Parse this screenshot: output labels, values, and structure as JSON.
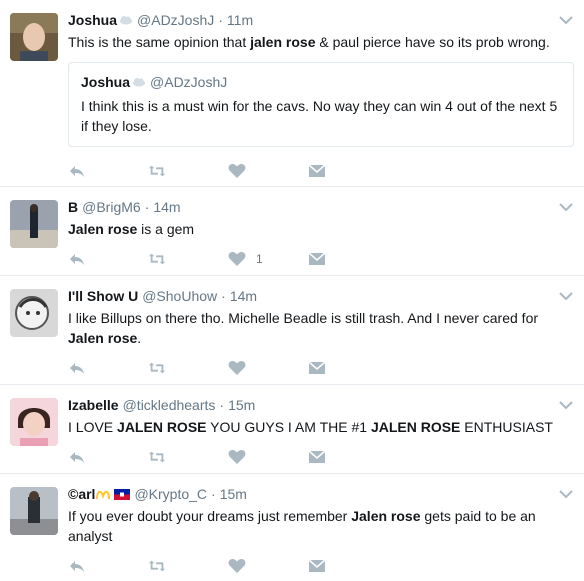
{
  "tweets": [
    {
      "name": "Joshua",
      "handle": "@ADzJoshJ",
      "time": "11m",
      "text_parts": [
        "This is the same opinion that ",
        "jalen rose",
        " & paul pierce have so its prob wrong."
      ],
      "quote": {
        "name": "Joshua",
        "handle": "@ADzJoshJ",
        "text": "I think this is a must win for the cavs. No way they can win 4 out of the next 5 if they lose."
      },
      "likes": ""
    },
    {
      "name": "B",
      "handle": "@BrigM6",
      "time": "14m",
      "text_parts": [
        "",
        "Jalen rose",
        " is a gem"
      ],
      "likes": "1"
    },
    {
      "name": "I'll Show U",
      "handle": "@ShoUhow",
      "time": "14m",
      "text_parts": [
        "I like Billups on there tho. Michelle Beadle is still trash. And I never cared for ",
        "Jalen rose",
        "."
      ],
      "likes": ""
    },
    {
      "name": "Izabelle",
      "handle": "@tickledhearts",
      "time": "15m",
      "text_parts": [
        "I LOVE ",
        "JALEN ROSE",
        " YOU GUYS I AM THE #1 ",
        "JALEN ROSE",
        " ENTHUSIAST"
      ],
      "likes": ""
    },
    {
      "name": "©arl",
      "handle": "@Krypto_C",
      "time": "15m",
      "text_parts": [
        "If you ever doubt your dreams just remember ",
        "Jalen rose",
        " gets paid to be an analyst"
      ],
      "likes": ""
    }
  ],
  "separator": "·",
  "icons": {
    "reply": "reply-icon",
    "retweet": "retweet-icon",
    "like": "heart-icon",
    "dm": "envelope-icon",
    "caret": "chevron-down-icon"
  },
  "colors": {
    "text": "#14171a",
    "muted": "#657786",
    "icon": "#aab8c2",
    "border": "#e6ecf0"
  }
}
